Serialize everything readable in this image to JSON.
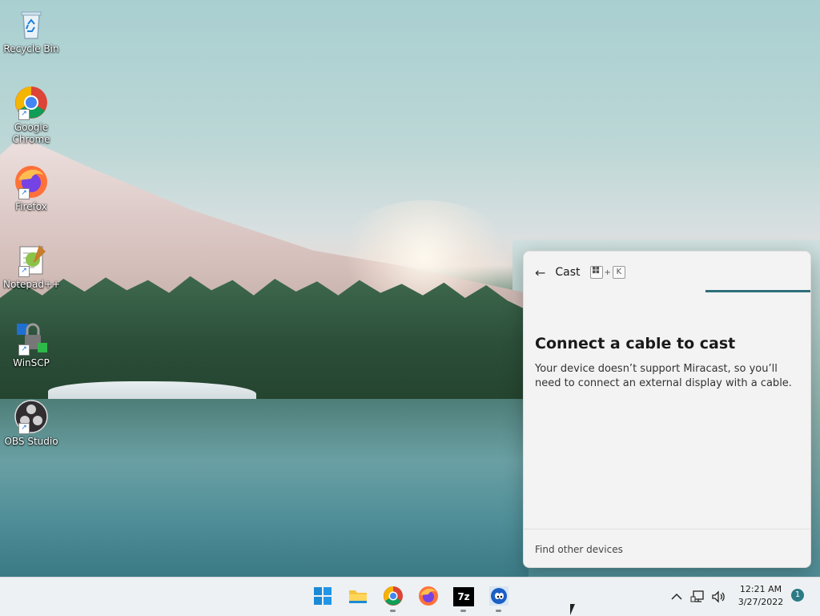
{
  "desktop": {
    "icons": [
      {
        "label": "Recycle Bin"
      },
      {
        "label": "Google Chrome"
      },
      {
        "label": "Firefox"
      },
      {
        "label": "Notepad++"
      },
      {
        "label": "WinSCP"
      },
      {
        "label": "OBS Studio"
      }
    ]
  },
  "cast_panel": {
    "title": "Cast",
    "shortcut_key": "K",
    "shortcut_plus": "+",
    "heading": "Connect a cable to cast",
    "description": "Your device doesn’t support Miracast, so you’ll need to connect an external display with a cable.",
    "footer_link": "Find other devices"
  },
  "taskbar": {
    "apps": [
      "start",
      "file-explorer",
      "chrome",
      "firefox",
      "7zip",
      "sonic"
    ],
    "seven_zip_label": "7z",
    "tray": {
      "time": "12:21 AM",
      "date": "3/27/2022",
      "notification_count": "1"
    }
  }
}
